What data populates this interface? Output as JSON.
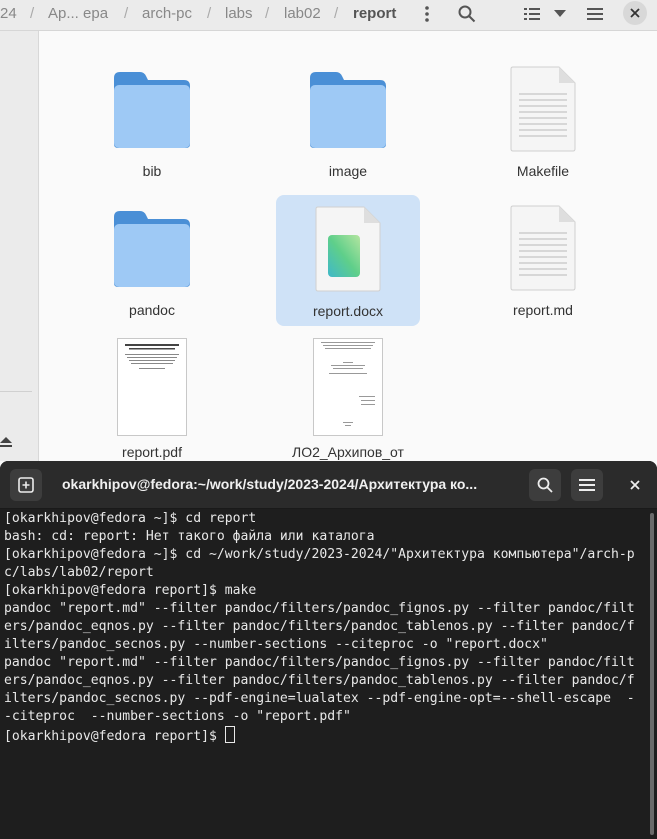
{
  "breadcrumb": [
    "24",
    "Ар... ера",
    "arch-pc",
    "labs",
    "lab02",
    "report"
  ],
  "files": [
    {
      "name": "bib",
      "kind": "folder"
    },
    {
      "name": "image",
      "kind": "folder"
    },
    {
      "name": "Makefile",
      "kind": "text"
    },
    {
      "name": "pandoc",
      "kind": "folder"
    },
    {
      "name": "report.docx",
      "kind": "docx"
    },
    {
      "name": "report.md",
      "kind": "text"
    },
    {
      "name": "report.pdf",
      "kind": "pdf"
    },
    {
      "name": "ЛО2_Архипов_от",
      "kind": "pdf"
    }
  ],
  "terminal": {
    "title": "okarkhipov@fedora:~/work/study/2023-2024/Архитектура ко...",
    "lines": [
      "[okarkhipov@fedora ~]$ cd report",
      "bash: cd: report: Нет такого файла или каталога",
      "[okarkhipov@fedora ~]$ cd ~/work/study/2023-2024/\"Архитектура компьютера\"/arch-p",
      "c/labs/lab02/report",
      "[okarkhipov@fedora report]$ make",
      "pandoc \"report.md\" --filter pandoc/filters/pandoc_fignos.py --filter pandoc/filt",
      "ers/pandoc_eqnos.py --filter pandoc/filters/pandoc_tablenos.py --filter pandoc/f",
      "ilters/pandoc_secnos.py --number-sections --citeproc -o \"report.docx\"",
      "pandoc \"report.md\" --filter pandoc/filters/pandoc_fignos.py --filter pandoc/filt",
      "ers/pandoc_eqnos.py --filter pandoc/filters/pandoc_tablenos.py --filter pandoc/f",
      "ilters/pandoc_secnos.py --pdf-engine=lualatex --pdf-engine-opt=--shell-escape  -",
      "-citeproc  --number-sections -o \"report.pdf\""
    ],
    "prompt": "[okarkhipov@fedora report]$ "
  }
}
